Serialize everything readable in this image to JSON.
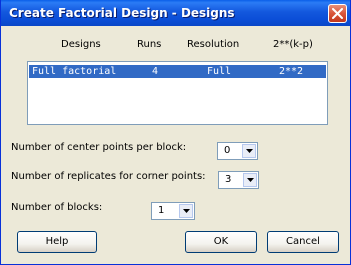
{
  "window": {
    "title": "Create Factorial Design - Designs"
  },
  "table": {
    "headers": [
      "Designs",
      "Runs",
      "Resolution",
      "2**(k-p)"
    ],
    "rows": [
      {
        "design": "Full factorial",
        "runs": "4",
        "resolution": "Full",
        "fraction": "2**2"
      }
    ]
  },
  "fields": {
    "center_points": {
      "label": "Number of center points per block:",
      "value": "0"
    },
    "replicates": {
      "label": "Number of replicates for corner points:",
      "value": "3"
    },
    "blocks": {
      "label": "Number of blocks:",
      "value": "1"
    }
  },
  "buttons": {
    "help": "Help",
    "ok": "OK",
    "cancel": "Cancel"
  },
  "colors": {
    "titlebar": "#0a5fe8",
    "selection": "#316ac5",
    "dialog_bg": "#ece9d8"
  },
  "icons": {
    "close": "close-icon",
    "dropdown": "chevron-down-icon"
  }
}
